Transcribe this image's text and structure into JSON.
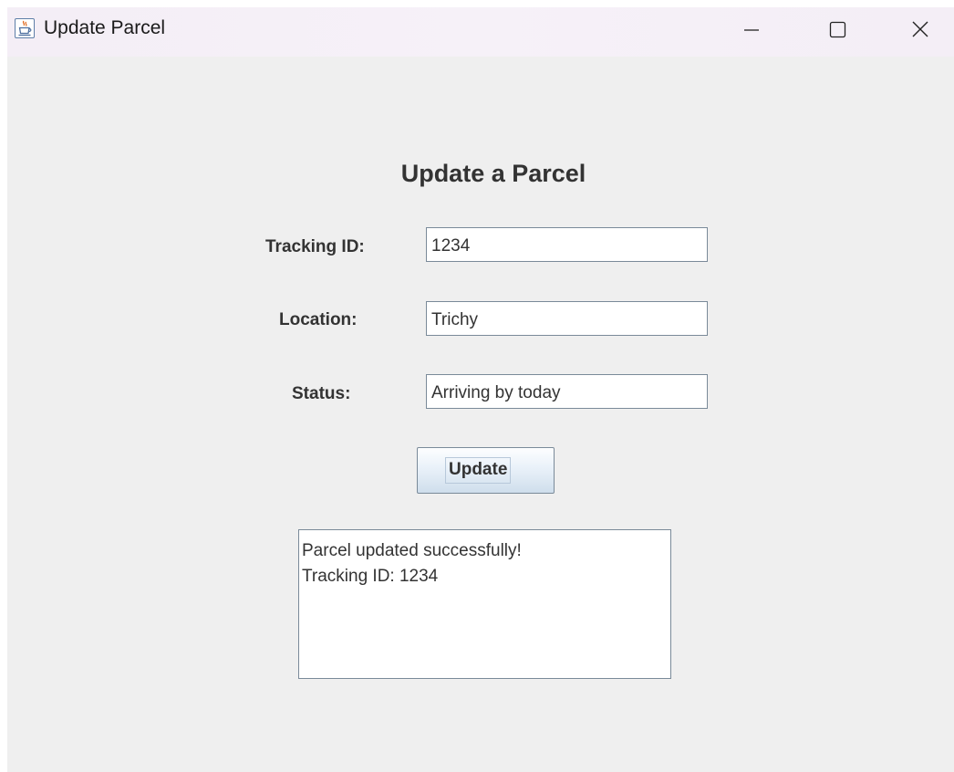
{
  "window": {
    "title": "Update Parcel",
    "icon": "java-cup-icon",
    "controls": [
      "minimize-icon",
      "maximize-icon",
      "close-icon"
    ]
  },
  "form": {
    "heading": "Update a Parcel",
    "tracking_id_label": "Tracking ID:",
    "tracking_id_value": "1234",
    "location_label": "Location:",
    "location_value": "Trichy",
    "status_label": "Status:",
    "status_value": "Arriving by today",
    "update_button_label": "Update"
  },
  "result": {
    "lines": [
      "Parcel updated successfully!",
      "Tracking ID: 1234"
    ]
  },
  "colors": {
    "background": "#efefef",
    "titlebar": "#f5f0f7",
    "text": "#333333",
    "border": "#7a8a99"
  }
}
